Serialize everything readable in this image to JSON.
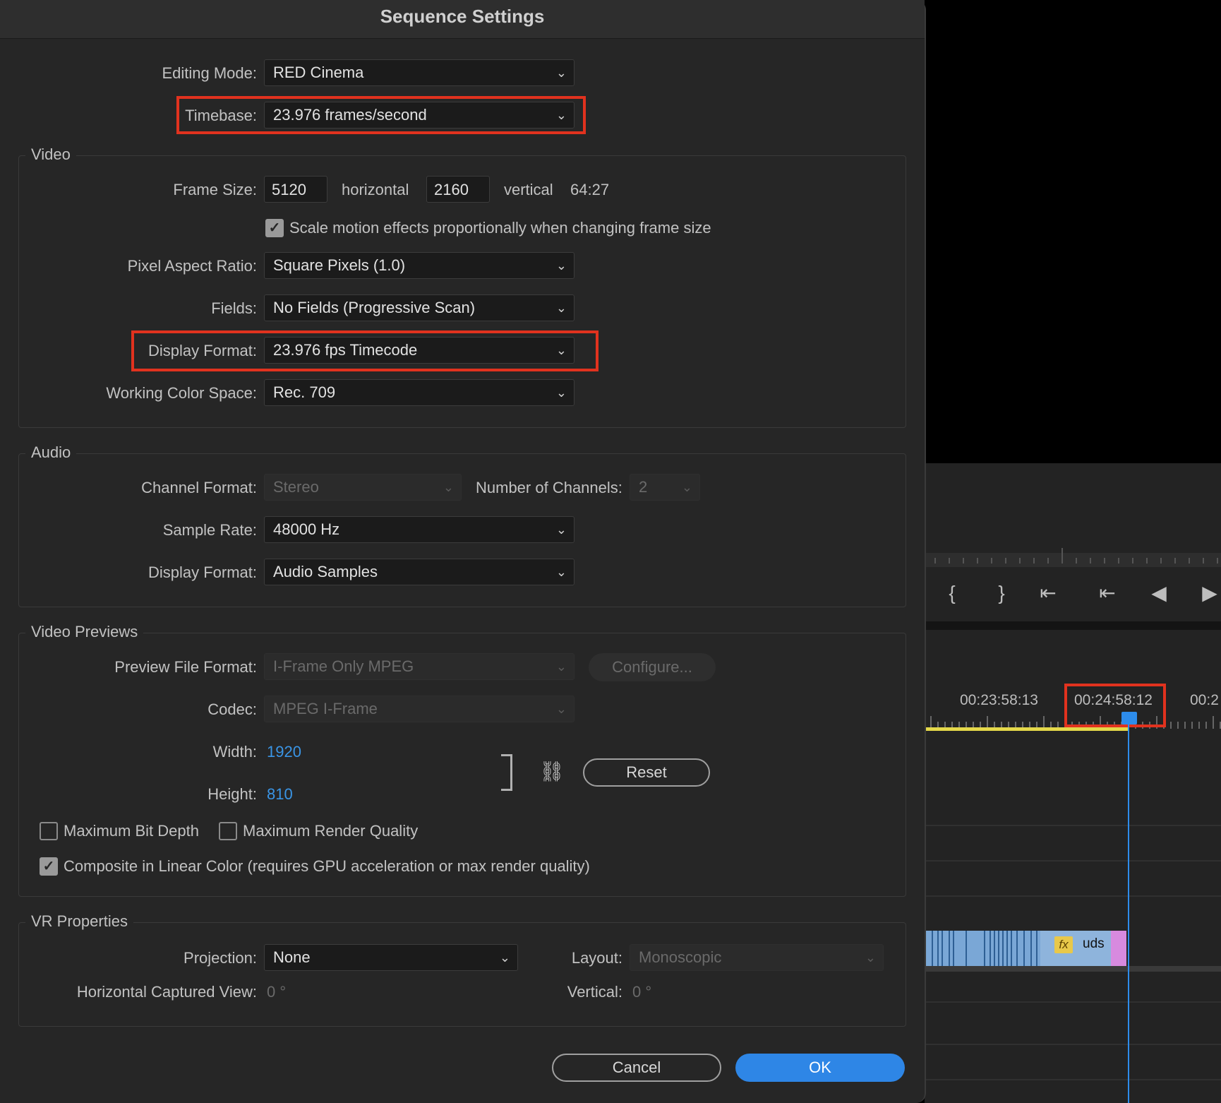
{
  "dialog": {
    "title": "Sequence Settings",
    "editing_mode": {
      "label": "Editing Mode:",
      "value": "RED Cinema"
    },
    "timebase": {
      "label": "Timebase:",
      "value": "23.976  frames/second"
    },
    "video": {
      "title": "Video",
      "frame_size_label": "Frame Size:",
      "width": "5120",
      "horizontal_label": "horizontal",
      "height": "2160",
      "vertical_label": "vertical",
      "aspect": "64:27",
      "scale_checkbox": "Scale motion effects proportionally when changing frame size",
      "pixel_aspect": {
        "label": "Pixel Aspect Ratio:",
        "value": "Square Pixels (1.0)"
      },
      "fields": {
        "label": "Fields:",
        "value": "No Fields (Progressive Scan)"
      },
      "display_format": {
        "label": "Display Format:",
        "value": "23.976 fps Timecode"
      },
      "color_space": {
        "label": "Working Color Space:",
        "value": "Rec. 709"
      }
    },
    "audio": {
      "title": "Audio",
      "channel_format": {
        "label": "Channel Format:",
        "value": "Stereo"
      },
      "num_channels": {
        "label": "Number of Channels:",
        "value": "2"
      },
      "sample_rate": {
        "label": "Sample Rate:",
        "value": "48000 Hz"
      },
      "display_format": {
        "label": "Display Format:",
        "value": "Audio Samples"
      }
    },
    "previews": {
      "title": "Video Previews",
      "file_format": {
        "label": "Preview File Format:",
        "value": "I-Frame Only MPEG"
      },
      "configure": "Configure...",
      "codec": {
        "label": "Codec:",
        "value": "MPEG I-Frame"
      },
      "width_label": "Width:",
      "width": "1920",
      "height_label": "Height:",
      "height": "810",
      "reset": "Reset",
      "max_bit_depth": "Maximum Bit Depth",
      "max_render_quality": "Maximum Render Quality",
      "linear_color": "Composite in Linear Color (requires GPU acceleration or max render quality)"
    },
    "vr": {
      "title": "VR Properties",
      "projection": {
        "label": "Projection:",
        "value": "None"
      },
      "layout": {
        "label": "Layout:",
        "value": "Monoscopic"
      },
      "hcv_label": "Horizontal Captured View:",
      "hcv_value": "0 °",
      "vertical_label": "Vertical:",
      "vertical_value": "0 °"
    },
    "cancel": "Cancel",
    "ok": "OK"
  },
  "timeline": {
    "timecodes": [
      "00:23:58:13",
      "00:24:58:12",
      "00:2"
    ],
    "clip_name": "uds",
    "fx_badge": "fx"
  },
  "colors": {
    "accent": "#2e86e6",
    "highlight": "#e1321e",
    "playhead": "#2d8ceb"
  }
}
